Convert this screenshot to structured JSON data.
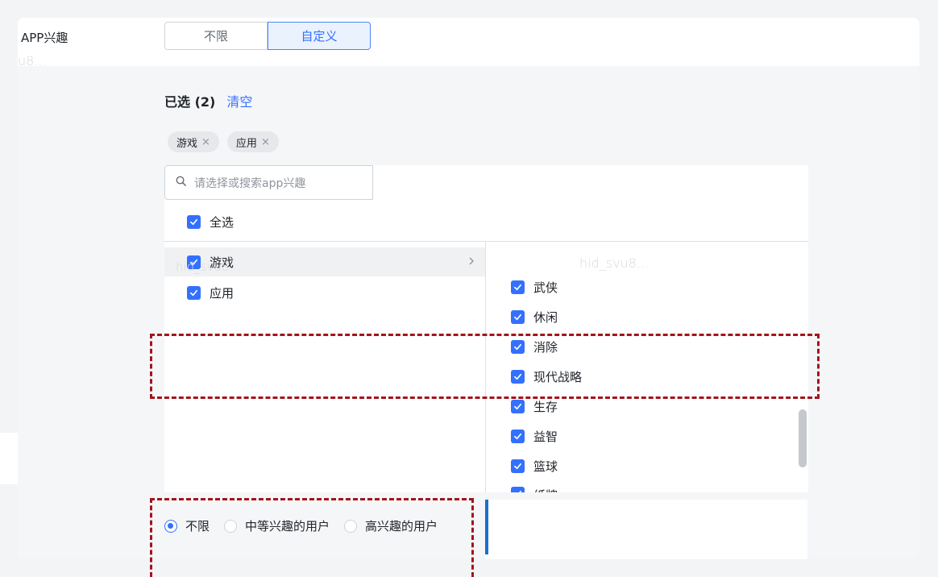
{
  "row_label": "APP兴趣",
  "watermark": "hid_svu8...",
  "watermark_fragment": "u8...",
  "segmented": {
    "option_unlimited": "不限",
    "option_custom": "自定义"
  },
  "selected": {
    "label": "已选 (2)",
    "clear": "清空"
  },
  "tags": [
    {
      "label": "游戏",
      "remove": "×"
    },
    {
      "label": "应用",
      "remove": "×"
    }
  ],
  "search": {
    "placeholder": "请选择或搜索app兴趣"
  },
  "select_all": "全选",
  "categories": [
    {
      "label": "游戏"
    },
    {
      "label": "应用"
    }
  ],
  "sub_items": [
    "武侠",
    "休闲",
    "消除",
    "现代战略",
    "生存",
    "益智",
    "篮球",
    "纸牌"
  ],
  "radios": [
    {
      "label": "不限",
      "checked": true
    },
    {
      "label": "中等兴趣的用户",
      "checked": false
    },
    {
      "label": "高兴趣的用户",
      "checked": false
    }
  ],
  "colors": {
    "accent": "#3370ff",
    "annotation": "#a3141c"
  }
}
